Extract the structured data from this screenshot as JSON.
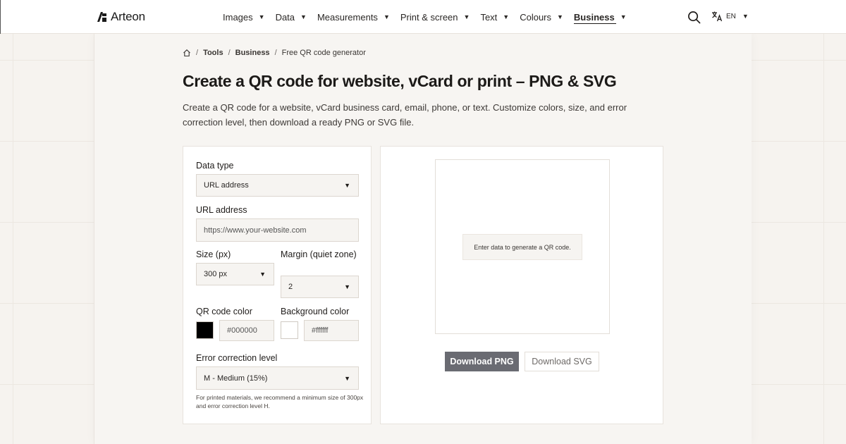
{
  "header": {
    "brand": "Arteon",
    "nav": [
      {
        "label": "Images"
      },
      {
        "label": "Data"
      },
      {
        "label": "Measurements"
      },
      {
        "label": "Print & screen"
      },
      {
        "label": "Text"
      },
      {
        "label": "Colours"
      },
      {
        "label": "Business",
        "active": true
      }
    ],
    "language": "EN",
    "search_icon": "search-icon",
    "translate_icon": "translate-icon"
  },
  "breadcrumb": {
    "home_icon": "home-icon",
    "items": [
      "Tools",
      "Business",
      "Free QR code generator"
    ]
  },
  "page": {
    "title": "Create a QR code for website, vCard or print – PNG & SVG",
    "description": "Create a QR code for a website, vCard business card, email, phone, or text. Customize colors, size, and error correction level, then download a ready PNG or SVG file."
  },
  "form": {
    "data_type": {
      "label": "Data type",
      "value": "URL address"
    },
    "url": {
      "label": "URL address",
      "placeholder": "https://www.your-website.com"
    },
    "size": {
      "label": "Size (px)",
      "value": "300 px"
    },
    "margin": {
      "label": "Margin (quiet zone)",
      "value": "2"
    },
    "qr_color": {
      "label": "QR code color",
      "value": "#000000",
      "swatch": "#000000"
    },
    "bg_color": {
      "label": "Background color",
      "value": "#ffffff",
      "swatch": "#ffffff"
    },
    "error_level": {
      "label": "Error correction level",
      "value": "M - Medium (15%)"
    },
    "hint": "For printed materials, we recommend a minimum size of 300px and error correction level H."
  },
  "preview": {
    "placeholder": "Enter data to generate a QR code.",
    "download_png": "Download PNG",
    "download_svg": "Download SVG"
  },
  "colors": {
    "accent_button": "#6a6b72",
    "page_bg": "#f6f3ef"
  }
}
